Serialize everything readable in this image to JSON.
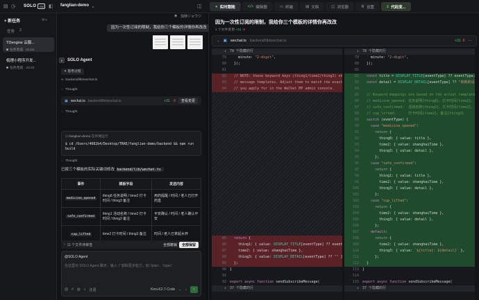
{
  "titlebar": {
    "brand": "SOLO",
    "brand_badge": "CN",
    "project": "fanglian-demo",
    "tabs": [
      {
        "label": "实时跟随",
        "icon": "●"
      },
      {
        "label": "编辑器",
        "icon": "</>"
      },
      {
        "label": "终端",
        "icon": "▭"
      },
      {
        "label": "文档",
        "icon": "▤"
      },
      {
        "label": "浏览器",
        "icon": "◫"
      },
      {
        "label": "设置",
        "icon": "⚙"
      },
      {
        "label": "代码变...",
        "icon": "±"
      }
    ]
  },
  "sidebar": {
    "new_task": "+ 新任务",
    "shortcut": "⌘N",
    "tasks_header": "任务",
    "tasks_count": "2",
    "tasks": [
      {
        "title": "TDengine 云服...",
        "status": "任务完成 · 01:04"
      },
      {
        "title": "梳理小程序开发...",
        "status": "任务完成 · 23:22"
      }
    ]
  },
  "chat": {
    "user_badge": "加持ジョウジ",
    "user_message": "因为一次性订阅的限制，我给你三个模板的详情你再改改",
    "agent_name": "SOLO Agent",
    "thinking_label": "思考过程",
    "file_ref": "backend/lib/wechat.ts",
    "thought1": "Thought",
    "edit": {
      "file": "wechat.ts",
      "path": "backend/lib/wechat.ts",
      "plus": "+31",
      "minus": "-8",
      "view": "查看变更"
    },
    "thought2": "Thought",
    "terminal": {
      "title": "fanglian-demo",
      "subtitle": "在终端运行",
      "command": "$ cd /Users/4682b4/Desktop/TRAE/fanglian-demo/backend && npm run build"
    },
    "thought3": "Thought",
    "summary_prefix": "已按三个模板的实际关键词修改",
    "summary_code": "backend/lib/wechat.ts",
    "summary_suffix": "：",
    "table": {
      "headers": [
        "事件",
        "模板字段",
        "发送内容"
      ],
      "rows": [
        {
          "event": "medicine_opened",
          "fields": "thing8 任务说明 / time2 打卡时间 / thing3 备注",
          "content": "用药提醒 / 时间 / 老人已打开药盒"
        },
        {
          "event": "safe_confirmed",
          "fields": "thing1 活动名称 / time2 打卡时间 / thing3 备注",
          "content": "平安确认 / 时间 / 老人确认平安"
        },
        {
          "event": "cup_lifted",
          "fields": "time2 打卡时间 / thing3 备注",
          "content": "时间 / 老人已拿起水杯"
        }
      ]
    },
    "pending": {
      "label": "11 个文件待审查",
      "reject": "全部撤销",
      "accept": "全部保留"
    },
    "input": {
      "mention": "@SOLO Agent",
      "placeholder": "在这里对 SOLO Agent 聊天，输入 '/' 获取更多能力，如 '/plan'、'/spec'",
      "model": "Kimi-K2.7-Code",
      "mode": "沈语"
    }
  },
  "review": {
    "title": "因为一次性订阅的限制，我给你三个模板的详情你再改改",
    "subtitle": "1 个文件变更",
    "plus": "+31",
    "minus": "-8",
    "file": "wechat.ts",
    "path": "backend/lib/wechat.ts",
    "hidden_top": "78 个隐藏的行",
    "hidden_bottom": "37 个隐藏的行"
  },
  "left_lines": [
    {
      "n": "79",
      "t": "    minute: \"2-digit\",",
      "k": "ctx"
    },
    {
      "n": "80",
      "t": "  });",
      "k": "ctx"
    },
    {
      "n": "81",
      "t": "",
      "k": "ctx"
    },
    {
      "n": "82",
      "t": "  // NOTE: these keyword keys (thing1/time2/thing3) should match your",
      "k": "del"
    },
    {
      "n": "83",
      "t": "  // message templates. Adjust them to match the exact keywords",
      "k": "del"
    },
    {
      "n": "84",
      "t": "  // you apply for in the WeChat MP admin console.",
      "k": "del"
    },
    {
      "n": "85",
      "t": "  return {",
      "k": "del"
    },
    {
      "n": "86",
      "t": "    thing1: { value: DISPLAY_TITLE[eventType] ?? eventType },",
      "k": "del"
    },
    {
      "n": "87",
      "t": "    time2: { value: shanghaiTime },",
      "k": "del"
    },
    {
      "n": "88",
      "t": "    thing3: { value: DISPLAY_DETAIL[eventType] ?? \"\" },",
      "k": "del"
    },
    {
      "n": "89",
      "t": "  };",
      "k": "del"
    },
    {
      "n": "90",
      "t": "}",
      "k": "ctx"
    },
    {
      "n": "91",
      "t": "",
      "k": "ctx"
    },
    {
      "n": "92",
      "t": "export async function sendSubscribeMessage(",
      "k": "ctx"
    }
  ],
  "right_lines": [
    {
      "n": "79",
      "t": "    minute: \"2-digit\",",
      "k": "ctx"
    },
    {
      "n": "80",
      "t": "  });",
      "k": "ctx"
    },
    {
      "n": "81",
      "t": "",
      "k": "ctx"
    },
    {
      "n": "82",
      "t": "  const title = DISPLAY_TITLE[eventType] ?? eventType;",
      "k": "add"
    },
    {
      "n": "83",
      "t": "  const detail = DISPLAY_DETAIL[eventType] ?? \"有新的设备事件\";",
      "k": "add"
    },
    {
      "n": "84",
      "t": "",
      "k": "add"
    },
    {
      "n": "85",
      "t": "  // Keyword mappings are based on the actual templates:",
      "k": "add"
    },
    {
      "n": "86",
      "t": "  // medicine_opened: 任务说明{thing8}、打卡时间{time2}、备注{thing3}",
      "k": "add"
    },
    {
      "n": "87",
      "t": "  // safe_confirmed:  活动名称{thing1}、打卡时间{time2}、备注{thing3}",
      "k": "add"
    },
    {
      "n": "88",
      "t": "  // cup_lifted:      打卡时间{time2}、备注{thing3}",
      "k": "add"
    },
    {
      "n": "89",
      "t": "  switch (eventType) {",
      "k": "add"
    },
    {
      "n": "90",
      "t": "    case \"medicine_opened\":",
      "k": "add"
    },
    {
      "n": "91",
      "t": "      return {",
      "k": "add"
    },
    {
      "n": "92",
      "t": "        thing8: { value: title },",
      "k": "add"
    },
    {
      "n": "93",
      "t": "        time2: { value: shanghaiTime },",
      "k": "add"
    },
    {
      "n": "94",
      "t": "        thing3: { value: detail },",
      "k": "add"
    },
    {
      "n": "95",
      "t": "      };",
      "k": "add"
    },
    {
      "n": "96",
      "t": "    case \"safe_confirmed\":",
      "k": "add"
    },
    {
      "n": "97",
      "t": "      return {",
      "k": "add"
    },
    {
      "n": "98",
      "t": "        thing1: { value: title },",
      "k": "add"
    },
    {
      "n": "99",
      "t": "        time2: { value: shanghaiTime },",
      "k": "add"
    },
    {
      "n": "100",
      "t": "        thing3: { value: detail },",
      "k": "add"
    },
    {
      "n": "101",
      "t": "      };",
      "k": "add"
    },
    {
      "n": "102",
      "t": "    case \"cup_lifted\":",
      "k": "add"
    },
    {
      "n": "103",
      "t": "      return {",
      "k": "add"
    },
    {
      "n": "104",
      "t": "        time2: { value: shanghaiTime },",
      "k": "add"
    },
    {
      "n": "105",
      "t": "        thing3: { value: detail },",
      "k": "add"
    },
    {
      "n": "106",
      "t": "      };",
      "k": "add"
    },
    {
      "n": "107",
      "t": "    default:",
      "k": "add"
    },
    {
      "n": "108",
      "t": "      return {",
      "k": "add"
    },
    {
      "n": "109",
      "t": "        time2: { value: shanghaiTime },",
      "k": "add"
    },
    {
      "n": "110",
      "t": "        thing3: { value: `${title}: ${detail}` },",
      "k": "add"
    },
    {
      "n": "111",
      "t": "      };",
      "k": "add"
    },
    {
      "n": "112",
      "t": "  }",
      "k": "add"
    },
    {
      "n": "113",
      "t": "}",
      "k": "ctx"
    },
    {
      "n": "114",
      "t": "",
      "k": "ctx"
    },
    {
      "n": "115",
      "t": "export async function sendSubscribeMessage(",
      "k": "ctx"
    }
  ]
}
